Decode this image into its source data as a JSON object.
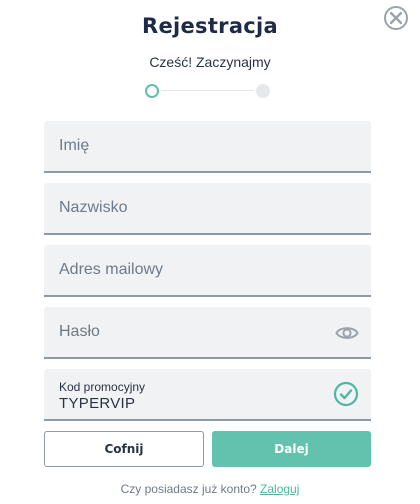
{
  "title": "Rejestracja",
  "subtitle": "Cześć! Zaczynajmy",
  "stepper": {
    "current_step": 1,
    "total_steps": 2
  },
  "fields": {
    "first_name": {
      "placeholder": "Imię",
      "value": ""
    },
    "last_name": {
      "placeholder": "Nazwisko",
      "value": ""
    },
    "email": {
      "placeholder": "Adres mailowy",
      "value": ""
    },
    "password": {
      "placeholder": "Hasło",
      "value": ""
    },
    "promo": {
      "label": "Kod promocyjny",
      "value": "TYPERVIP"
    }
  },
  "buttons": {
    "back_label": "Cofnij",
    "next_label": "Dalej"
  },
  "footer": {
    "question": "Czy posiadasz już konto?",
    "login_link": "Zaloguj"
  },
  "icons": {
    "close": "close-icon",
    "eye": "eye-icon",
    "check": "check-circle-icon"
  },
  "colors": {
    "accent": "#62c2ae",
    "title": "#1e2a48",
    "field_bg": "#f0f2f4"
  }
}
